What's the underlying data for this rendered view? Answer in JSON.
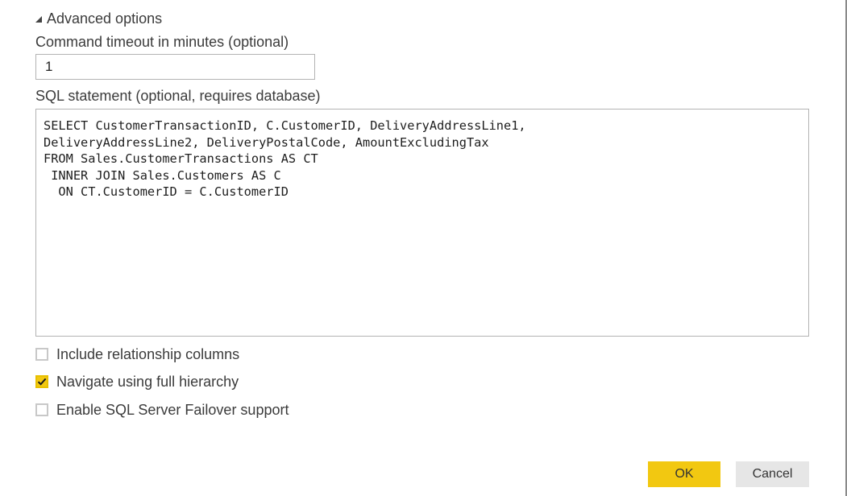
{
  "advanced": {
    "toggle_label": "Advanced options"
  },
  "timeout": {
    "label": "Command timeout in minutes (optional)",
    "value": "1"
  },
  "sql": {
    "label": "SQL statement (optional, requires database)",
    "value": "SELECT CustomerTransactionID, C.CustomerID, DeliveryAddressLine1,\nDeliveryAddressLine2, DeliveryPostalCode, AmountExcludingTax\nFROM Sales.CustomerTransactions AS CT\n INNER JOIN Sales.Customers AS C\n  ON CT.CustomerID = C.CustomerID"
  },
  "options": {
    "include_relationship": {
      "label": "Include relationship columns",
      "checked": false
    },
    "navigate_hierarchy": {
      "label": "Navigate using full hierarchy",
      "checked": true
    },
    "failover_support": {
      "label": "Enable SQL Server Failover support",
      "checked": false
    }
  },
  "buttons": {
    "ok_label": "OK",
    "cancel_label": "Cancel"
  },
  "colors": {
    "accent": "#f2c811",
    "cancel_bg": "#e6e6e6",
    "border": "#b3b3b3"
  },
  "icons": {
    "toggle": "collapse-triangle-icon",
    "check": "checkmark-icon"
  }
}
